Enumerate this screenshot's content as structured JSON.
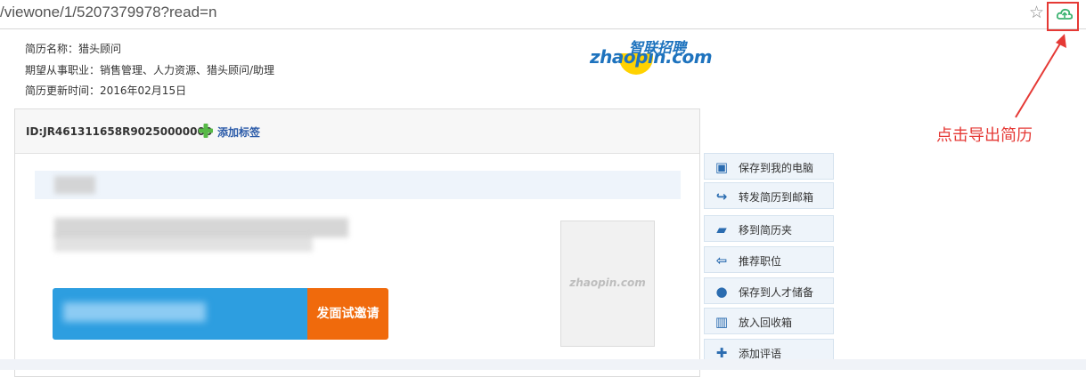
{
  "browser": {
    "url": "/viewone/1/5207379978?read=n"
  },
  "resume_meta": {
    "name_line": "简历名称：猎头顾问",
    "expected_line": "期望从事职业：销售管理、人力资源、猎头顾问/助理",
    "updated_line": "简历更新时间：2016年02月15日"
  },
  "logo": {
    "top_text": "智联招聘",
    "main_text": "zhaopin.com"
  },
  "resume": {
    "id_label": "ID:JR461311658R90250000000",
    "add_tag_label": "添加标签",
    "photo_watermark": "zhaopin.com",
    "invite_button_label": "发面试邀请"
  },
  "actions": [
    {
      "label": "保存到我的电脑",
      "icon": "save-icon"
    },
    {
      "label": "转发简历到邮箱",
      "icon": "forward-icon"
    },
    {
      "label": "移到简历夹",
      "icon": "folder-icon"
    },
    {
      "label": "推荐职位",
      "icon": "recommend-icon"
    },
    {
      "label": "保存到人才储备",
      "icon": "person-icon"
    },
    {
      "label": "放入回收箱",
      "icon": "trash-icon"
    },
    {
      "label": "添加评语",
      "icon": "plus-icon"
    }
  ],
  "annotation": {
    "text": "点击导出简历"
  },
  "colors": {
    "accent_blue": "#2d9ee0",
    "invite_orange": "#f06a0c",
    "annotation_red": "#e53935"
  }
}
